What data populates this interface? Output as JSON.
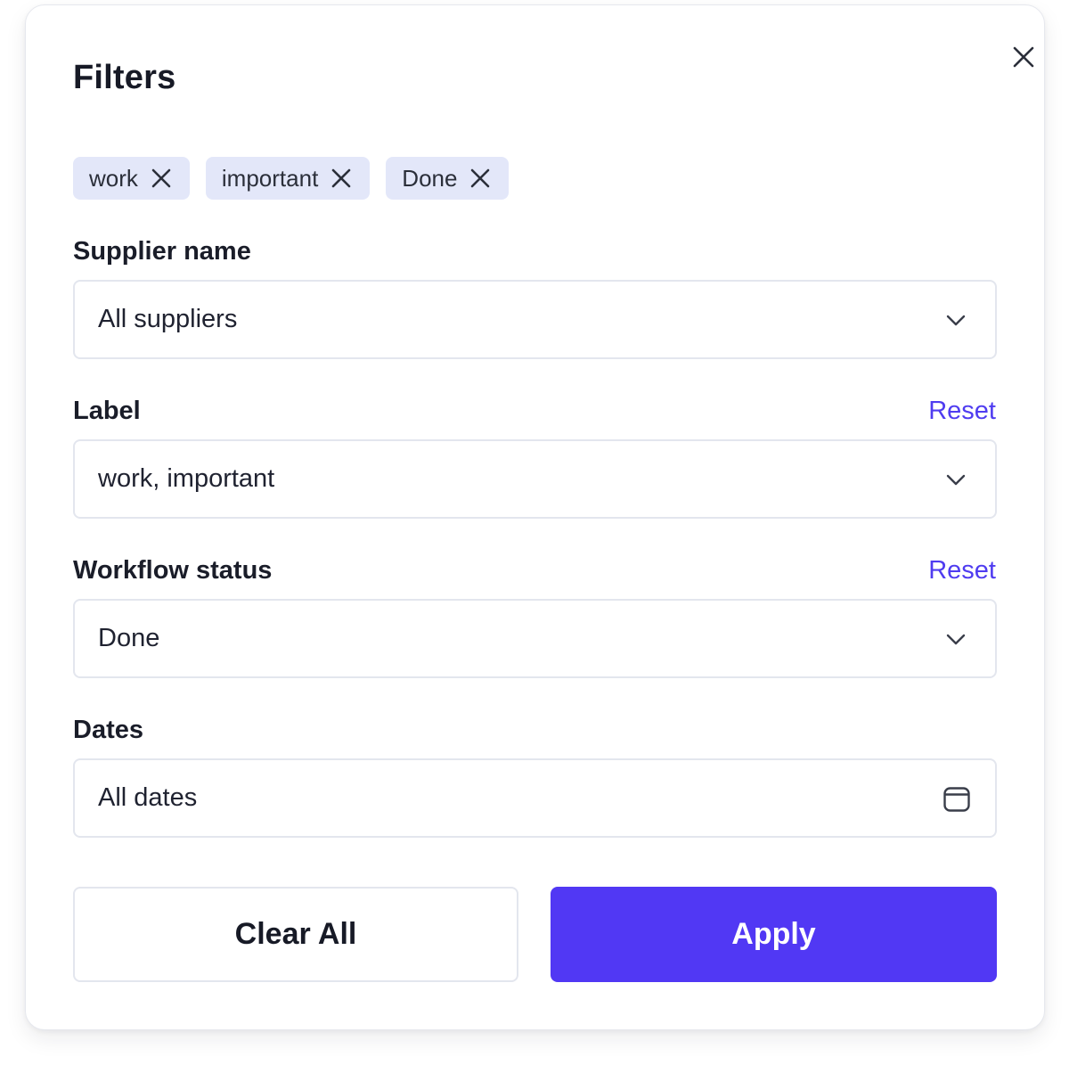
{
  "dialog": {
    "title": "Filters"
  },
  "chips": [
    {
      "label": "work"
    },
    {
      "label": "important"
    },
    {
      "label": "Done"
    }
  ],
  "fields": {
    "supplier": {
      "label": "Supplier name",
      "value": "All suppliers"
    },
    "label": {
      "label": "Label",
      "value": "work, important",
      "reset": "Reset"
    },
    "workflow": {
      "label": "Workflow status",
      "value": "Done",
      "reset": "Reset"
    },
    "dates": {
      "label": "Dates",
      "value": "All dates"
    }
  },
  "actions": {
    "clear_label": "Clear All",
    "apply_label": "Apply"
  },
  "icons": {
    "close": "close-icon",
    "chip_remove": "x-icon",
    "dropdown": "chevron-down-icon",
    "calendar": "calendar-icon"
  },
  "colors": {
    "accent": "#5138f4",
    "link": "#4f3cf0",
    "chip_bg": "#e3e7f9"
  }
}
